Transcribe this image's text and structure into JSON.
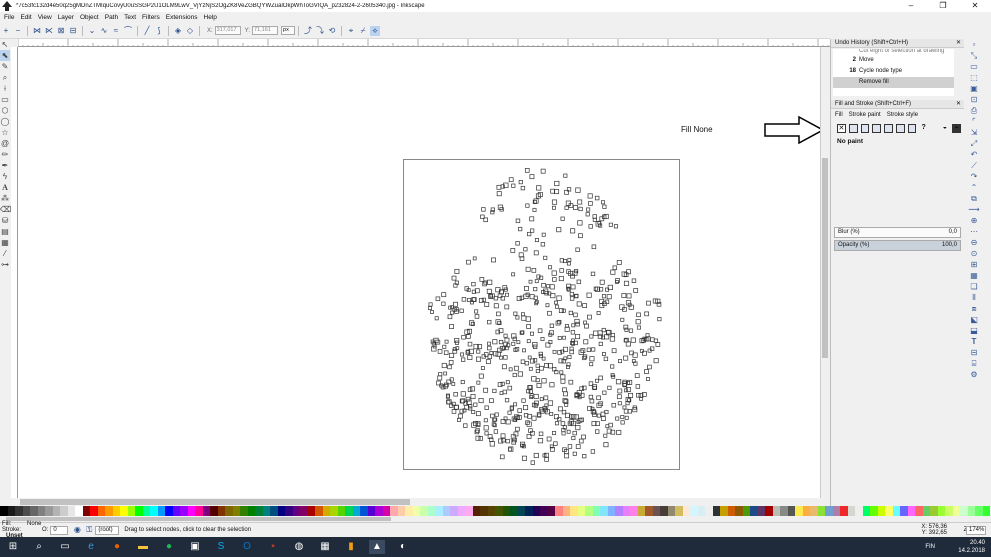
{
  "window": {
    "title": "*7c53fc132d4e50q25gMDnZTMIquCovyU0uSSGP2U1OLM9LwV_VjYzNjS2OgZK8VeZGBQYWZualOkpWhToGVIQA_p232824-2-2605340.jpg - Inkscape",
    "min_glyph": "–",
    "max_glyph": "❐",
    "close_glyph": "✕"
  },
  "menu": [
    "File",
    "Edit",
    "View",
    "Layer",
    "Object",
    "Path",
    "Text",
    "Filters",
    "Extensions",
    "Help"
  ],
  "toolbar": {
    "x_label": "X:",
    "x_value": "317,017",
    "y_label": "Y:",
    "y_value": "71,161",
    "unit": "px"
  },
  "canvas": {
    "annotation": "Fill None"
  },
  "undo_history": {
    "title": "Undo History (Shift+Ctrl+H)",
    "rows": [
      {
        "num": "",
        "label": "Cut eight of selection at drawing"
      },
      {
        "num": "2",
        "label": "Move"
      },
      {
        "num": "18",
        "label": "Cycle node type"
      },
      {
        "num": "",
        "label": "Remove fill"
      }
    ]
  },
  "fill_stroke": {
    "title": "Fill and Stroke (Shift+Ctrl+F)",
    "tab_fill": "Fill",
    "tab_stroke_paint": "Stroke paint",
    "tab_stroke_style": "Stroke style",
    "paint_state": "No paint",
    "blur_label": "Blur (%)",
    "blur_value": "0,0",
    "opacity_label": "Opacity (%)",
    "opacity_value": "100,0"
  },
  "status": {
    "fill_label": "Fill:",
    "fill_value": "None",
    "stroke_label": "Stroke:",
    "stroke_value": "Unset",
    "opacity_label": "O:",
    "opacity_value": "0",
    "layer": "(root)",
    "message": "Drag to select nodes, click to clear the selection",
    "x_coord": "X: 576,36",
    "y_coord": "Y: 392,65",
    "z_label": "Z:",
    "zoom": "174%"
  },
  "taskbar": {
    "lang": "FIN",
    "time": "20.40",
    "date": "14.2.2018"
  },
  "colors": {
    "palette": [
      "#000000",
      "#1a1a1a",
      "#333333",
      "#4d4d4d",
      "#666666",
      "#808080",
      "#999999",
      "#b3b3b3",
      "#cccccc",
      "#e6e6e6",
      "#ffffff",
      "#800000",
      "#ff0000",
      "#ff6600",
      "#ff9900",
      "#ffcc00",
      "#ffff00",
      "#99ff00",
      "#00ff00",
      "#00ff99",
      "#00ffff",
      "#0099ff",
      "#0000ff",
      "#6600ff",
      "#9900ff",
      "#ff00ff",
      "#ff0099",
      "#800080",
      "#550000",
      "#803300",
      "#806600",
      "#808000",
      "#338000",
      "#008000",
      "#008033",
      "#008080",
      "#004d80",
      "#000080",
      "#330080",
      "#660080",
      "#800066",
      "#aa0000",
      "#d45500",
      "#d4aa00",
      "#aad400",
      "#55d400",
      "#00d455",
      "#00aad4",
      "#0055d4",
      "#5500d4",
      "#aa00d4",
      "#d400aa",
      "#ffaaaa",
      "#ffccaa",
      "#ffeeaa",
      "#eeffaa",
      "#ccffaa",
      "#aaffcc",
      "#aaeeff",
      "#aaccff",
      "#ccaaff",
      "#eeaaff",
      "#ffaaee",
      "#552200",
      "#553300",
      "#554400",
      "#445500",
      "#225500",
      "#005522",
      "#004455",
      "#002255",
      "#220055",
      "#440055",
      "#550044",
      "#ff8080",
      "#ffb380",
      "#ffe680",
      "#e6ff80",
      "#b3ff80",
      "#80ffb3",
      "#80e6ff",
      "#80b3ff",
      "#b380ff",
      "#e680ff",
      "#ff80e6",
      "#c8ab37",
      "#a05a2c",
      "#6c5353",
      "#483e37",
      "#918a6f",
      "#d3bc5f",
      "#ffe6d5",
      "#d5f6ff",
      "#d7eef4",
      "#eeeeec",
      "#2e3436",
      "#c4a000",
      "#ce5c00",
      "#8f5902",
      "#4e9a06",
      "#204a87",
      "#5c3566",
      "#a40000",
      "#babdb6",
      "#888a85",
      "#555753",
      "#fce94f",
      "#fcaf3e",
      "#e9b96e",
      "#8ae234",
      "#729fcf",
      "#ad7fa8",
      "#ef2929",
      "#d3d7cf",
      "#eeeeec",
      "#00ff66",
      "#66ff00",
      "#ccff00",
      "#ffff66",
      "#66ffff",
      "#6666ff",
      "#ff66ff",
      "#ff6666",
      "#66cc66",
      "#99cc33",
      "#99ff33",
      "#ccff66",
      "#eeff99",
      "#ccffcc",
      "#99ff99",
      "#66ff66",
      "#33ff33"
    ]
  }
}
